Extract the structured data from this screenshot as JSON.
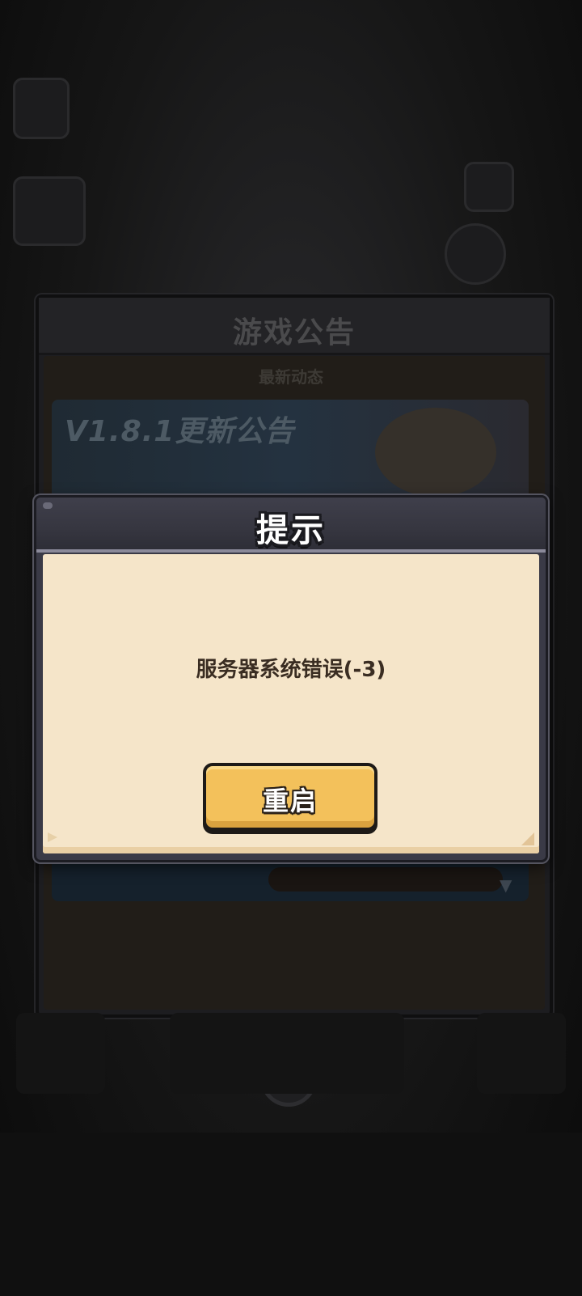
{
  "background": {
    "announcement_panel": {
      "title": "游戏公告",
      "subtitle": "最新动态",
      "banner_title": "V1.8.1更新公告"
    },
    "close_icon": "close-icon"
  },
  "dialog": {
    "title": "提示",
    "message": "服务器系统错误(-3)",
    "restart_label": "重启"
  },
  "colors": {
    "dialog_header": "#3a3a46",
    "dialog_body": "#f5e5c9",
    "button_fill": "#f3c15b",
    "text_dark": "#3a2d22"
  }
}
